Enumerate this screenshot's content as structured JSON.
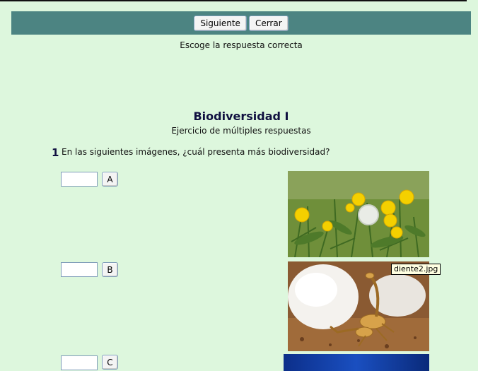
{
  "toolbar": {
    "next_label": "Siguiente",
    "close_label": "Cerrar"
  },
  "instruction": "Escoge la respuesta correcta",
  "exercise": {
    "title": "Biodiversidad I",
    "subtitle": "Ejercicio de múltiples respuestas"
  },
  "question": {
    "number": "1",
    "text": "En las siguientes imágenes, ¿cuál presenta más biodiversidad?",
    "options": [
      {
        "letter": "A",
        "value": ""
      },
      {
        "letter": "B",
        "value": ""
      },
      {
        "letter": "C",
        "value": ""
      }
    ]
  },
  "tooltip": "diente2.jpg",
  "colors": {
    "background": "#ddf7dd",
    "toolbar": "#4c8482",
    "title": "#101040"
  }
}
